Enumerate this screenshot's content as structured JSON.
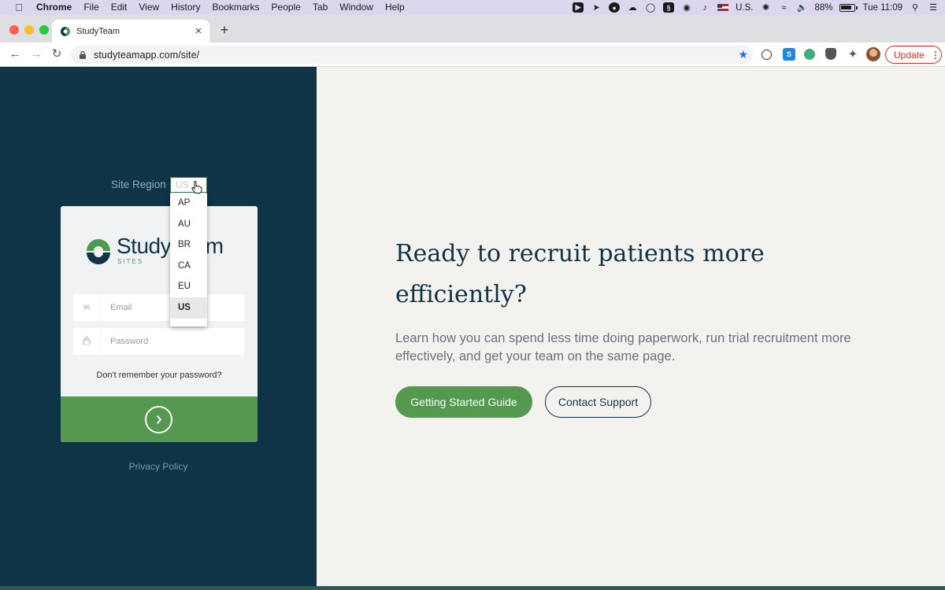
{
  "menubar": {
    "items": [
      "Chrome",
      "File",
      "Edit",
      "View",
      "History",
      "Bookmarks",
      "People",
      "Tab",
      "Window",
      "Help"
    ],
    "input_source": "U.S.",
    "battery": "88%",
    "clock": "Tue 11:09"
  },
  "tab": {
    "title": "StudyTeam",
    "close": "×",
    "new_tab": "+"
  },
  "toolbar": {
    "url": "studyteamapp.com/site/",
    "update_label": "Update",
    "update_menu": "⋮",
    "extensions": [
      "S"
    ]
  },
  "login": {
    "region_label": "Site Region",
    "region_value": "US",
    "region_options": [
      "AP",
      "AU",
      "BR",
      "CA",
      "EU",
      "US"
    ],
    "selected_option": "US",
    "logo_text": "StudyTeam",
    "logo_sub": "SITES",
    "email_placeholder": "Email",
    "password_placeholder": "Password",
    "forgot_label": "Don't remember your password?",
    "privacy_label": "Privacy Policy"
  },
  "hero": {
    "headline": "Ready to recruit patients more efficiently?",
    "description": "Learn how you can spend less time doing paperwork, run trial recruitment more effectively, and get your team on the same page.",
    "primary_cta": "Getting Started Guide",
    "secondary_cta": "Contact Support"
  },
  "colors": {
    "brand_dark": "#0f3347",
    "brand_green": "#559950",
    "page_bg": "#f4f2ef"
  }
}
